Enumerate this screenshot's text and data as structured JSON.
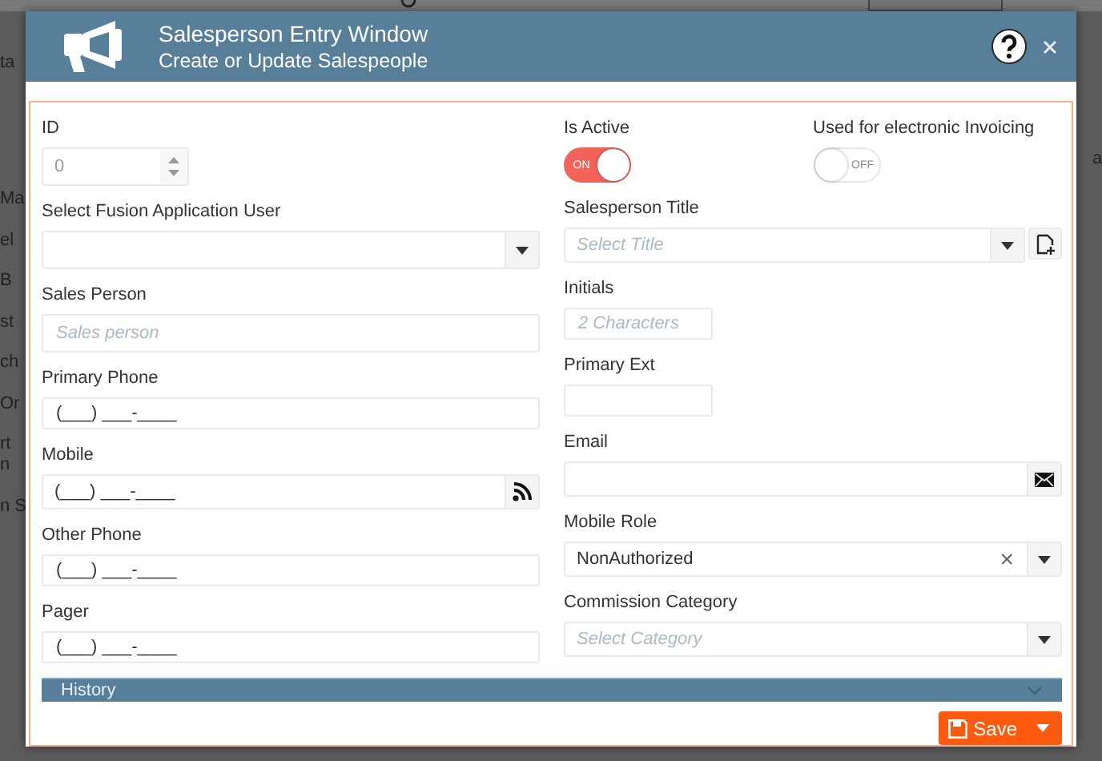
{
  "background": {
    "header_fragment": "ta",
    "left_fragments": [
      "Ma",
      "el",
      "B",
      "st",
      "ch",
      "Or",
      "rt",
      "n",
      "n S"
    ],
    "right_fragment": "a"
  },
  "window": {
    "title": "Salesperson Entry Window",
    "subtitle": "Create or Update Salespeople"
  },
  "left_fields": [
    {
      "label": "ID",
      "kind": "number",
      "placeholder": "0"
    },
    {
      "label": "Select Fusion Application User",
      "kind": "select"
    },
    {
      "label": "Sales Person",
      "kind": "text",
      "placeholder": "Sales person"
    },
    {
      "label": "Primary Phone",
      "kind": "masked",
      "value": "(___) ___-____"
    },
    {
      "label": "Mobile",
      "kind": "masked-feed",
      "value": "(___) ___-____"
    },
    {
      "label": "Other Phone",
      "kind": "masked",
      "value": "(___) ___-____"
    },
    {
      "label": "Pager",
      "kind": "masked",
      "value": "(___) ___-____"
    }
  ],
  "toggles": [
    {
      "label": "Is Active",
      "on": true,
      "text": "ON"
    },
    {
      "label": "Used for electronic Invoicing",
      "on": false,
      "text": "OFF"
    }
  ],
  "right_fields": [
    {
      "label": "Salesperson Title",
      "kind": "select-add",
      "placeholder": "Select Title"
    },
    {
      "label": "Initials",
      "kind": "short",
      "placeholder": "2 Characters"
    },
    {
      "label": "Primary Ext",
      "kind": "short"
    },
    {
      "label": "Email",
      "kind": "mail"
    },
    {
      "label": "Mobile Role",
      "kind": "select-clear",
      "value": "NonAuthorized",
      "clear_mark": "×"
    },
    {
      "label": "Commission Category",
      "kind": "select",
      "placeholder": "Select Category"
    }
  ],
  "history": {
    "label": "History",
    "expanded": false
  },
  "save_button": {
    "label": "Save"
  }
}
